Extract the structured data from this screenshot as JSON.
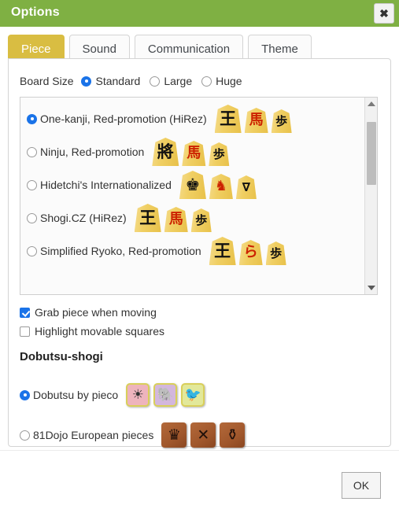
{
  "window": {
    "title": "Options",
    "close_icon": "close-icon",
    "accent_green": "#7fb043",
    "accent_gold": "#d9bd42",
    "select_blue": "#1a73e8"
  },
  "tabs": [
    {
      "label": "Piece",
      "active": true
    },
    {
      "label": "Sound",
      "active": false
    },
    {
      "label": "Communication",
      "active": false
    },
    {
      "label": "Theme",
      "active": false
    }
  ],
  "board_size": {
    "label": "Board Size",
    "options": [
      {
        "label": "Standard",
        "selected": true
      },
      {
        "label": "Large",
        "selected": false
      },
      {
        "label": "Huge",
        "selected": false
      }
    ]
  },
  "piece_list": {
    "scroll": {
      "up_icon": "scroll-up-arrow-icon",
      "down_icon": "scroll-down-arrow-icon",
      "thumb_position_pct": 7,
      "thumb_size_pct": 36
    },
    "items": [
      {
        "label": "One-kanji, Red-promotion (HiRez)",
        "selected": true,
        "pieces": [
          {
            "glyph": "王",
            "color": "black",
            "size": "k"
          },
          {
            "glyph": "馬",
            "color": "red",
            "size": "m"
          },
          {
            "glyph": "歩",
            "color": "black",
            "size": "s"
          }
        ]
      },
      {
        "label": "Ninju, Red-promotion",
        "selected": false,
        "pieces": [
          {
            "glyph": "將",
            "color": "black",
            "size": "k"
          },
          {
            "glyph": "馬",
            "color": "red",
            "size": "m"
          },
          {
            "glyph": "歩",
            "color": "black",
            "size": "s"
          }
        ]
      },
      {
        "label": "Hidetchi's Internationalized",
        "selected": false,
        "pieces": [
          {
            "glyph": "♚",
            "color": "black",
            "size": "k"
          },
          {
            "glyph": "♞",
            "color": "red",
            "size": "m"
          },
          {
            "glyph": "∇",
            "color": "black",
            "size": "s"
          }
        ]
      },
      {
        "label": "Shogi.CZ (HiRez)",
        "selected": false,
        "pieces": [
          {
            "glyph": "王",
            "color": "black",
            "size": "k"
          },
          {
            "glyph": "馬",
            "color": "red",
            "size": "m"
          },
          {
            "glyph": "歩",
            "color": "black",
            "size": "s"
          }
        ]
      },
      {
        "label": "Simplified Ryoko, Red-promotion",
        "selected": false,
        "pieces": [
          {
            "glyph": "王",
            "color": "black",
            "size": "k"
          },
          {
            "glyph": "ら",
            "color": "red",
            "size": "m"
          },
          {
            "glyph": "歩",
            "color": "black",
            "size": "s"
          }
        ]
      }
    ]
  },
  "checkboxes": [
    {
      "label": "Grab piece when moving",
      "checked": true
    },
    {
      "label": "Highlight movable squares",
      "checked": false
    }
  ],
  "dobutsu": {
    "heading": "Dobutsu-shogi",
    "options": [
      {
        "label": "Dobutsu by pieco",
        "selected": true,
        "tiles": [
          {
            "glyph": "☀",
            "theme": "pink",
            "name": "lion-tile"
          },
          {
            "glyph": "🐘",
            "theme": "purple",
            "name": "elephant-tile"
          },
          {
            "glyph": "🐦",
            "theme": "green",
            "name": "chick-tile"
          }
        ]
      },
      {
        "label": "81Dojo European pieces",
        "selected": false,
        "tiles": [
          {
            "glyph": "♛",
            "theme": "euro",
            "name": "crown-tile"
          },
          {
            "glyph": "✕",
            "theme": "euro",
            "name": "crossed-arrows-tile"
          },
          {
            "glyph": "⚱",
            "theme": "euro",
            "name": "eagle-tile"
          }
        ]
      }
    ]
  },
  "footer": {
    "ok_label": "OK"
  }
}
